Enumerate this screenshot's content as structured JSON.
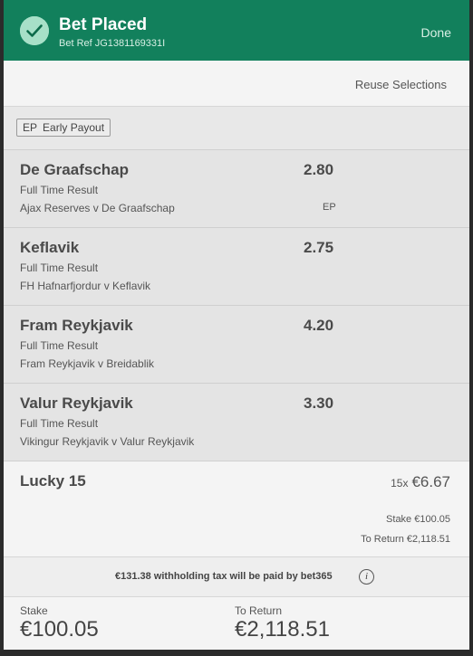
{
  "header": {
    "title": "Bet Placed",
    "bet_ref": "Bet Ref JG1381169331I",
    "done_label": "Done",
    "accent_color": "#12805c",
    "icon": "check-circle-icon"
  },
  "reuse_label": "Reuse Selections",
  "early_payout": {
    "code": "EP",
    "label": "Early Payout"
  },
  "selections": [
    {
      "name": "De Graafschap",
      "odds": "2.80",
      "market": "Full Time Result",
      "event": "Ajax Reserves v De Graafschap",
      "badge": "EP"
    },
    {
      "name": "Keflavik",
      "odds": "2.75",
      "market": "Full Time Result",
      "event": "FH Hafnarfjordur v Keflavik",
      "badge": ""
    },
    {
      "name": "Fram Reykjavik",
      "odds": "4.20",
      "market": "Full Time Result",
      "event": "Fram Reykjavik v Breidablik",
      "badge": ""
    },
    {
      "name": "Valur Reykjavik",
      "odds": "3.30",
      "market": "Full Time Result",
      "event": "Vikingur Reykjavik v Valur Reykjavik",
      "badge": ""
    }
  ],
  "bet": {
    "type": "Lucky 15",
    "lines": "15x",
    "unit_stake": "€6.67",
    "stake_text": "Stake €100.05",
    "return_text": "To Return €2,118.51"
  },
  "tax_notice": "€131.38 withholding tax will be paid by bet365",
  "totals": {
    "stake_label": "Stake",
    "stake_value": "€100.05",
    "return_label": "To Return",
    "return_value": "€2,118.51"
  }
}
